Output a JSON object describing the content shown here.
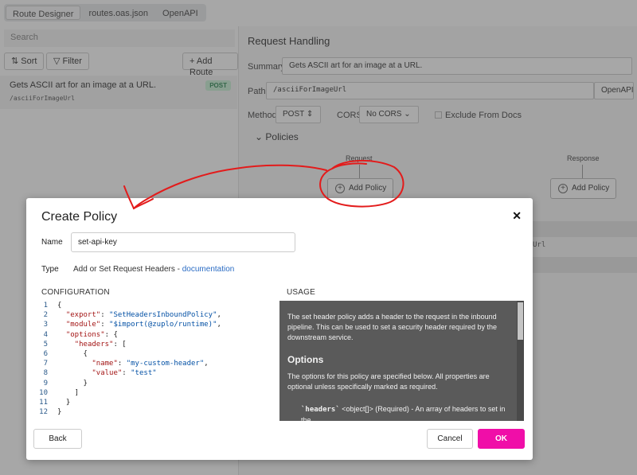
{
  "background": {
    "tabs": [
      "Route Designer",
      "routes.oas.json",
      "OpenAPI"
    ],
    "search_placeholder": "Search",
    "sort_label": "Sort",
    "filter_label": "Filter",
    "add_route_label": "+ Add Route",
    "route": {
      "title": "Gets ASCII art for an image at a URL.",
      "path": "/asciiForImageUrl",
      "method_badge": "POST"
    },
    "request_handling": {
      "title": "Request Handling",
      "summary_label": "Summary",
      "summary_value": "Gets ASCII art for an image at a URL.",
      "path_label": "Path",
      "path_value": "/asciiForImageUrl",
      "openapi_label": "OpenAPI",
      "method_label": "Method",
      "method_value": "POST",
      "cors_label": "CORS",
      "cors_value": "No CORS",
      "exclude_label": "Exclude From Docs",
      "policies_label": "Policies",
      "request_label": "Request",
      "response_label": "Response",
      "add_policy_label": "Add Policy",
      "partial_url": "Url"
    }
  },
  "modal": {
    "title": "Create Policy",
    "close_glyph": "✕",
    "name_label": "Name",
    "name_value": "set-api-key",
    "type_label": "Type",
    "type_text": "Add or Set Request Headers - ",
    "type_link": "documentation",
    "config_heading": "CONFIGURATION",
    "usage_heading": "USAGE",
    "code_lines": [
      {
        "n": "1",
        "text": "{"
      },
      {
        "n": "2",
        "text": "  \"export\": \"SetHeadersInboundPolicy\","
      },
      {
        "n": "3",
        "text": "  \"module\": \"$import(@zuplo/runtime)\","
      },
      {
        "n": "4",
        "text": "  \"options\": {"
      },
      {
        "n": "5",
        "text": "    \"headers\": ["
      },
      {
        "n": "6",
        "text": "      {"
      },
      {
        "n": "7",
        "text": "        \"name\": \"my-custom-header\","
      },
      {
        "n": "8",
        "text": "        \"value\": \"test\""
      },
      {
        "n": "9",
        "text": "      }"
      },
      {
        "n": "10",
        "text": "    ]"
      },
      {
        "n": "11",
        "text": "  }"
      },
      {
        "n": "12",
        "text": "}"
      }
    ],
    "usage_intro": "The set header policy adds a header to the request in the inbound pipeline. This can be used to set a security header required by the downstream service.",
    "usage_options_heading": "Options",
    "usage_options_text": "The options for this policy are specified below. All properties are optional unless specifically marked as required.",
    "usage_headers_code": "`headers`",
    "usage_headers_text": " <object[]> (Required) - An array of headers to set in the",
    "back_label": "Back",
    "cancel_label": "Cancel",
    "ok_label": "OK"
  },
  "colors": {
    "accent": "#f00ea8",
    "annotation": "#e31b1b",
    "link": "#2b6cc4",
    "usage_bg": "#5a5a5a"
  }
}
